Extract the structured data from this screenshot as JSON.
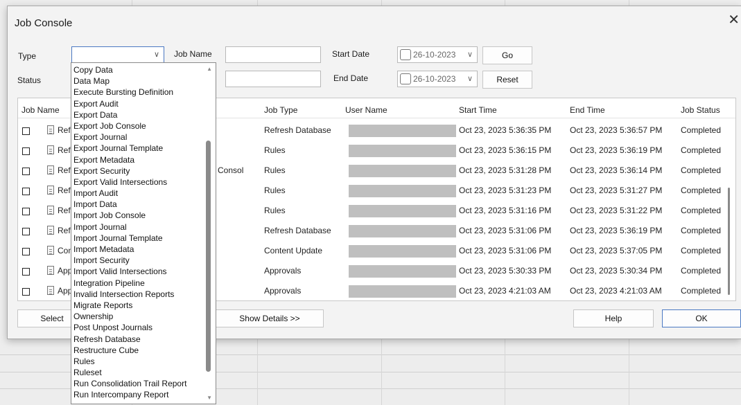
{
  "window": {
    "title": "Job Console"
  },
  "filters": {
    "type_label": "Type",
    "type_value": "",
    "status_label": "Status",
    "job_name_label": "Job Name",
    "job_name_value": "",
    "start_date_label": "Start Date",
    "start_date_value": "26-10-2023",
    "end_date_label": "End Date",
    "end_date_value": "26-10-2023",
    "go_label": "Go",
    "reset_label": "Reset"
  },
  "table": {
    "columns": [
      "Job Name",
      "Job Type",
      "User Name",
      "Start Time",
      "End Time",
      "Job Status"
    ],
    "rows": [
      {
        "job_name": "Refr",
        "job_type": "Refresh Database",
        "start": "Oct 23, 2023 5:36:35 PM",
        "end": "Oct 23, 2023 5:36:57 PM",
        "status": "Completed"
      },
      {
        "job_name": "Refr",
        "job_type": "Rules",
        "start": "Oct 23, 2023 5:36:15 PM",
        "end": "Oct 23, 2023 5:36:19 PM",
        "status": "Completed"
      },
      {
        "job_name": "Refr",
        "job_type": "Rules",
        "start": "Oct 23, 2023 5:31:28 PM",
        "end": "Oct 23, 2023 5:36:14 PM",
        "status": "Completed"
      },
      {
        "job_name": "Refr",
        "job_type": "Rules",
        "start": "Oct 23, 2023 5:31:23 PM",
        "end": "Oct 23, 2023 5:31:27 PM",
        "status": "Completed"
      },
      {
        "job_name": "Refr",
        "job_type": "Rules",
        "start": "Oct 23, 2023 5:31:16 PM",
        "end": "Oct 23, 2023 5:31:22 PM",
        "status": "Completed"
      },
      {
        "job_name": "Refr",
        "job_type": "Refresh Database",
        "start": "Oct 23, 2023 5:31:06 PM",
        "end": "Oct 23, 2023 5:36:19 PM",
        "status": "Completed"
      },
      {
        "job_name": "Cont",
        "job_type": "Content Update",
        "start": "Oct 23, 2023 5:31:06 PM",
        "end": "Oct 23, 2023 5:37:05 PM",
        "status": "Completed"
      },
      {
        "job_name": "Appr",
        "job_type": "Approvals",
        "start": "Oct 23, 2023 5:30:33 PM",
        "end": "Oct 23, 2023 5:30:34 PM",
        "status": "Completed"
      },
      {
        "job_name": "Appr",
        "job_type": "Approvals",
        "start": "Oct 23, 2023 4:21:03 AM",
        "end": "Oct 23, 2023 4:21:03 AM",
        "status": "Completed"
      }
    ],
    "partial_text": "Consol"
  },
  "footer": {
    "select_label": "Select",
    "show_details_label": "Show Details >>",
    "help_label": "Help",
    "ok_label": "OK"
  },
  "type_dropdown": {
    "options": [
      "Copy Data",
      "Data Map",
      "Execute Bursting Definition",
      "Export Audit",
      "Export Data",
      "Export Job Console",
      "Export Journal",
      "Export Journal Template",
      "Export Metadata",
      "Export Security",
      "Export Valid Intersections",
      "Import Audit",
      "Import Data",
      "Import Job Console",
      "Import Journal",
      "Import Journal Template",
      "Import Metadata",
      "Import Security",
      "Import Valid Intersections",
      "Integration Pipeline",
      "Invalid Intersection Reports",
      "Migrate Reports",
      "Ownership",
      "Post Unpost Journals",
      "Refresh Database",
      "Restructure Cube",
      "Rules",
      "Ruleset",
      "Run Consolidation Trail Report",
      "Run Intercompany Report"
    ]
  },
  "icons": {
    "close": "close-icon",
    "dropdown": "chevron-down-icon",
    "calendar": "calendar-icon",
    "job_doc": "document-icon"
  },
  "colors": {
    "accent": "#4a78c2",
    "masked_user": "#bfbfbf"
  }
}
